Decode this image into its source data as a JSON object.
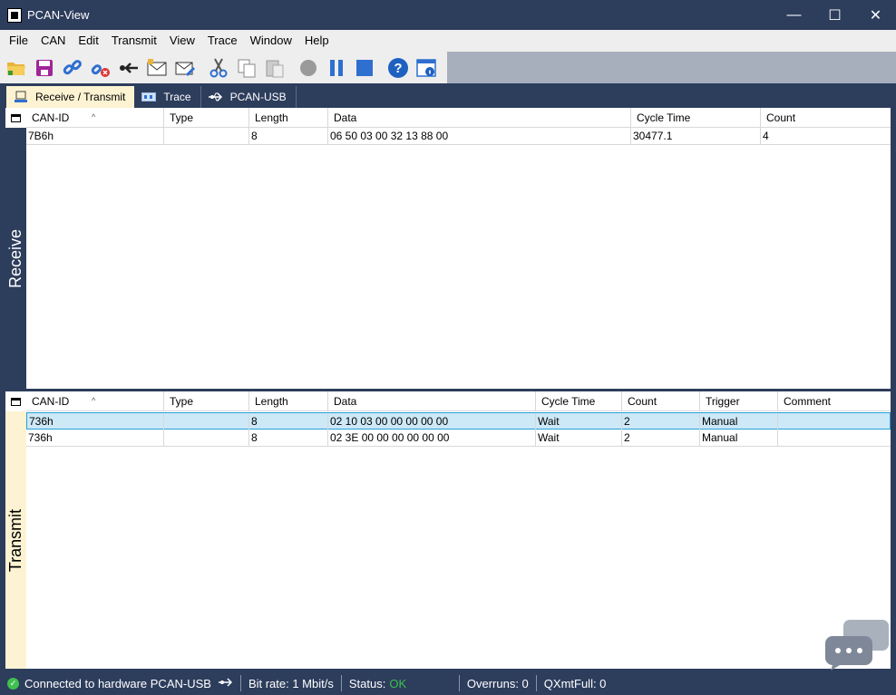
{
  "window": {
    "title": "PCAN-View",
    "minimize": "—",
    "maximize": "☐",
    "close": "✕"
  },
  "menu": [
    "File",
    "CAN",
    "Edit",
    "Transmit",
    "View",
    "Trace",
    "Window",
    "Help"
  ],
  "tabs": [
    {
      "label": "Receive / Transmit",
      "icon": "computer-icon"
    },
    {
      "label": "Trace",
      "icon": "trace-icon"
    },
    {
      "label": "PCAN-USB",
      "icon": "usb-icon"
    }
  ],
  "receive": {
    "label": "Receive",
    "columns": [
      "CAN-ID",
      "Type",
      "Length",
      "Data",
      "Cycle Time",
      "Count"
    ],
    "rows": [
      {
        "can_id": "7B6h",
        "type": "",
        "length": "8",
        "data": "06 50 03 00 32 13 88 00",
        "cycle_time": "30477.1",
        "count": "4"
      }
    ]
  },
  "transmit": {
    "label": "Transmit",
    "columns": [
      "CAN-ID",
      "Type",
      "Length",
      "Data",
      "Cycle Time",
      "Count",
      "Trigger",
      "Comment"
    ],
    "rows": [
      {
        "can_id": "736h",
        "type": "",
        "length": "8",
        "data": "02 10 03 00 00 00 00 00",
        "cycle_time": "Wait",
        "count": "2",
        "trigger": "Manual",
        "comment": ""
      },
      {
        "can_id": "736h",
        "type": "",
        "length": "8",
        "data": "02 3E 00 00 00 00 00 00",
        "cycle_time": "Wait",
        "count": "2",
        "trigger": "Manual",
        "comment": ""
      }
    ]
  },
  "status": {
    "connected": "Connected to hardware PCAN-USB",
    "bitrate": "Bit rate: 1 Mbit/s",
    "status_label": "Status:",
    "status_value": "OK",
    "overruns": "Overruns: 0",
    "qxmtfull": "QXmtFull: 0"
  },
  "colors": {
    "accent": "#2d3d5c",
    "panel": "#fdf3d2",
    "ok": "#3fc04f",
    "selection": "#cde8f7"
  }
}
